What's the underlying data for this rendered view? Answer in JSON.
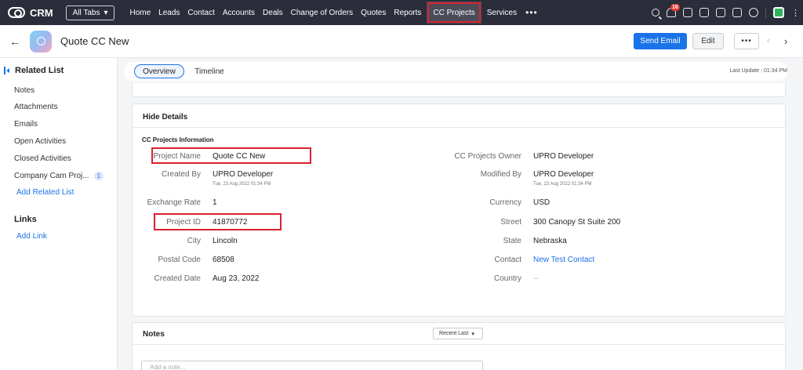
{
  "app": {
    "name": "CRM"
  },
  "nav": {
    "all_tabs": "All Tabs",
    "items": [
      "Home",
      "Leads",
      "Contact",
      "Accounts",
      "Deals",
      "Change of Orders",
      "Quotes",
      "Reports",
      "CC Projects",
      "Services"
    ],
    "active": "CC Projects",
    "more": "•••",
    "notification_count": "16"
  },
  "record": {
    "title": "Quote CC New",
    "send_email": "Send Email",
    "edit": "Edit",
    "more": "•••"
  },
  "sidebar": {
    "related_list": "Related List",
    "items": [
      "Notes",
      "Attachments",
      "Emails",
      "Open Activities",
      "Closed Activities",
      "Company Cam Proj..."
    ],
    "company_cam_count": "1",
    "add_related_list": "Add Related List",
    "links": "Links",
    "add_link": "Add Link"
  },
  "tabs": {
    "overview": "Overview",
    "timeline": "Timeline",
    "last_update": "Last Update : 01:34 PM"
  },
  "details": {
    "hide_details": "Hide Details",
    "section_title": "CC Projects Information",
    "left": [
      {
        "label": "Project Name",
        "value": "Quote CC New"
      },
      {
        "label": "Created By",
        "value": "UPRO Developer",
        "sub": "Tue, 23 Aug 2022 01:34 PM"
      },
      {
        "label": "Exchange Rate",
        "value": "1"
      },
      {
        "label": "Project ID",
        "value": "41870772"
      },
      {
        "label": "City",
        "value": "Lincoln"
      },
      {
        "label": "Postal Code",
        "value": "68508"
      },
      {
        "label": "Created Date",
        "value": "Aug 23, 2022"
      }
    ],
    "right": [
      {
        "label": "CC Projects Owner",
        "value": "UPRO Developer"
      },
      {
        "label": "Modified By",
        "value": "UPRO Developer",
        "sub": "Tue, 23 Aug 2022 01:34 PM"
      },
      {
        "label": "Currency",
        "value": "USD"
      },
      {
        "label": "Street",
        "value": "300 Canopy St Suite 200"
      },
      {
        "label": "State",
        "value": "Nebraska"
      },
      {
        "label": "Contact",
        "value": "New Test Contact"
      },
      {
        "label": "Country",
        "value": "--"
      }
    ]
  },
  "notes": {
    "title": "Notes",
    "sort": "Recent Last",
    "placeholder": "Add a note..."
  }
}
